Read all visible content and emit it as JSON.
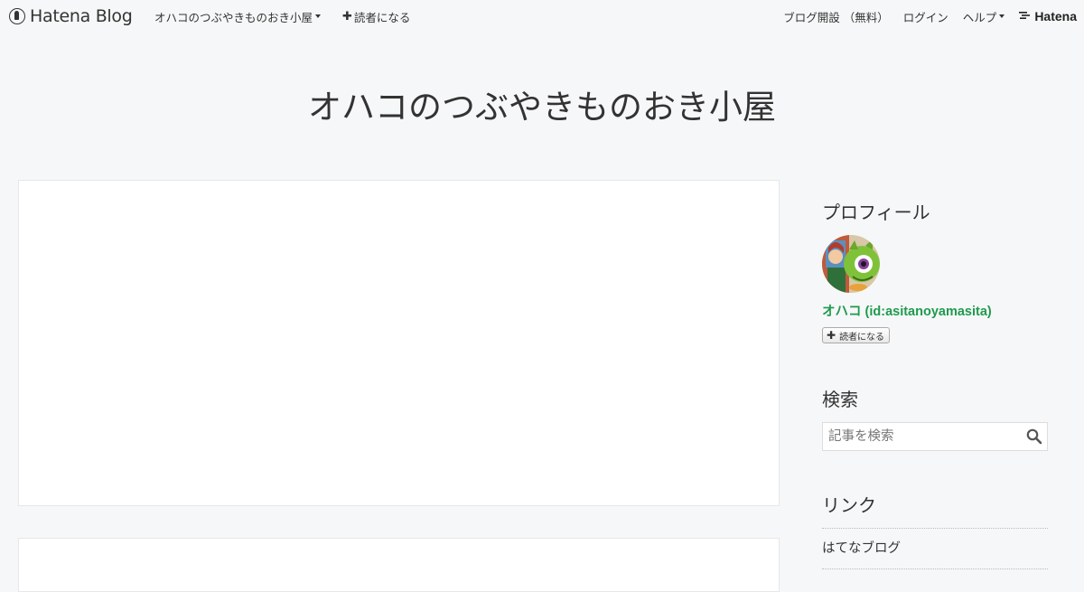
{
  "topbar": {
    "logo_text": "Hatena Blog",
    "blog_menu_label": "オハコのつぶやきものおき小屋",
    "subscribe_label": "読者になる",
    "open_blog_label": "ブログ開設 （無料）",
    "login_label": "ログイン",
    "help_label": "ヘルプ",
    "brand_label": "Hatena"
  },
  "blog": {
    "title": "オハコのつぶやきものおき小屋"
  },
  "sidebar": {
    "profile": {
      "heading": "プロフィール",
      "name": "オハコ (id:asitanoyamasita)",
      "subscribe_label": "読者になる"
    },
    "search": {
      "heading": "検索",
      "placeholder": "記事を検索"
    },
    "links": {
      "heading": "リンク",
      "items": [
        {
          "label": "はてなブログ"
        }
      ]
    }
  },
  "colors": {
    "background": "#f6f7f8",
    "profile_name": "#1f9a4e",
    "text": "#333333"
  }
}
